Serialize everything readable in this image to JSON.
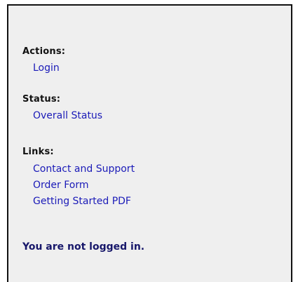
{
  "sidebar": {
    "actions": {
      "heading": "Actions:",
      "items": [
        {
          "label": "Login"
        }
      ]
    },
    "status": {
      "heading": "Status:",
      "items": [
        {
          "label": "Overall Status"
        }
      ]
    },
    "links": {
      "heading": "Links:",
      "items": [
        {
          "label": "Contact and Support"
        },
        {
          "label": "Order Form"
        },
        {
          "label": "Getting Started PDF"
        }
      ]
    },
    "login_status": "You are not logged in."
  },
  "colors": {
    "panel_background": "#efefef",
    "border": "#111111",
    "link": "#1b1bb8",
    "status_text": "#17176a"
  }
}
